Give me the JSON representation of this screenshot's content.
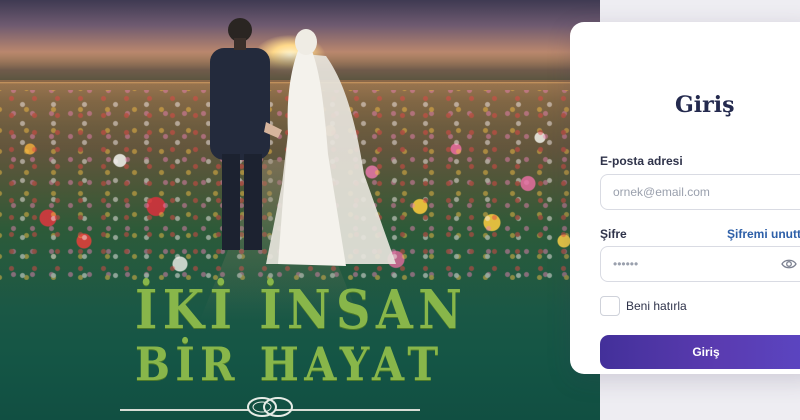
{
  "hero": {
    "title_line1": "İKİ İNSAN",
    "title_line2": "BİR HAYAT",
    "title_color": "#88b64a"
  },
  "login": {
    "title": "Giriş",
    "email_label": "E-posta adresi",
    "email_placeholder": "ornek@email.com",
    "password_label": "Şifre",
    "forgot_link": "Şifremi unuttum",
    "password_value": "••••••",
    "remember_label": "Beni hatırla",
    "remember_checked": false,
    "submit_label": "Giriş",
    "accent_color": "#4b34a6",
    "link_color": "#2d5fa8"
  },
  "icons": {
    "password_toggle": "eye-icon",
    "rings": "wedding-rings-icon"
  }
}
